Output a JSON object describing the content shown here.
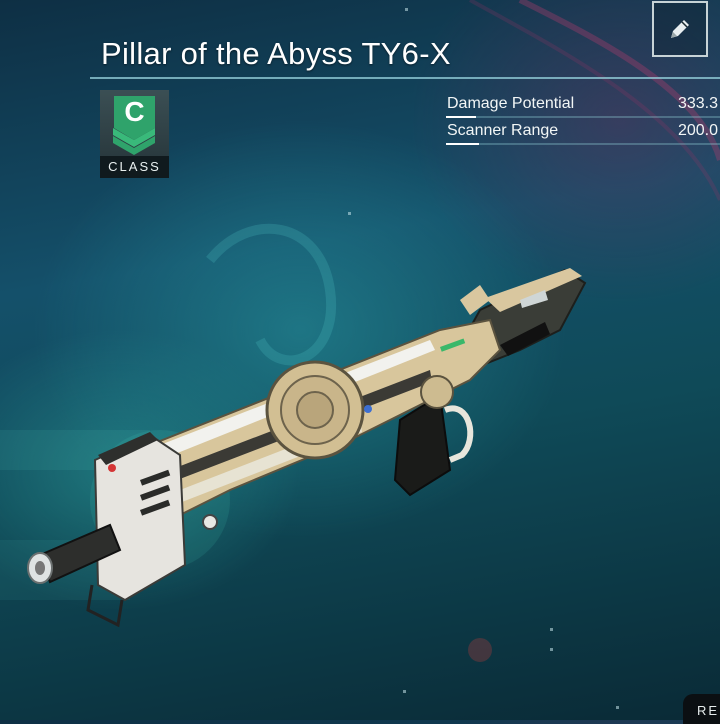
{
  "weapon": {
    "name": "Pillar of the Abyss TY6-X",
    "class_letter": "C",
    "class_label": "CLASS"
  },
  "stats": [
    {
      "label": "Damage Potential",
      "value": "333.3",
      "fill": 0.11
    },
    {
      "label": "Scanner Range",
      "value": "200.0",
      "fill": 0.12
    }
  ],
  "controls": {
    "edit_icon": "pencil-icon",
    "corner_label": "RE"
  },
  "colors": {
    "class_badge": "#2fa36b",
    "accent_line": "#96d2dc",
    "text": "#ffffff"
  }
}
